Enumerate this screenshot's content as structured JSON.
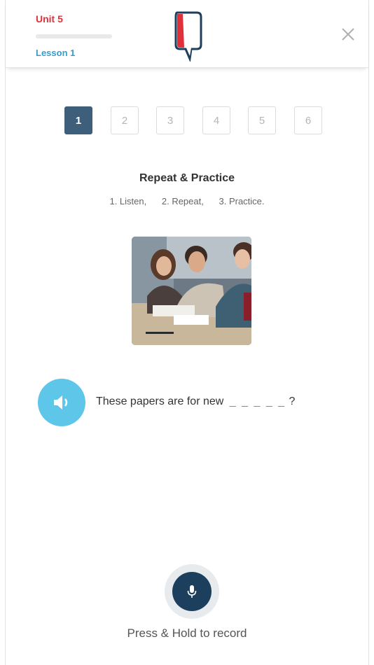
{
  "header": {
    "unit": "Unit 5",
    "lesson": "Lesson 1",
    "progress": 0,
    "close_icon": "close-icon",
    "logo_icon": "speech-bubble-logo"
  },
  "steps": [
    "1",
    "2",
    "3",
    "4",
    "5",
    "6"
  ],
  "active_step": "1",
  "activity": {
    "title": "Repeat & Practice",
    "instructions": [
      "1. Listen,",
      "2. Repeat,",
      "3. Practice."
    ]
  },
  "exercise": {
    "audio_icon": "speaker-icon",
    "sentence": "These papers are for new",
    "blank": "_ _ _ _ _",
    "end": "?"
  },
  "record": {
    "mic_icon": "microphone-icon",
    "label": "Press & Hold to record"
  },
  "colors": {
    "unit_red": "#e0313b",
    "lesson_blue": "#3a9bc9",
    "active_step": "#3e5f7b",
    "audio_button": "#5ec6e8",
    "mic_button": "#1c3f5e"
  }
}
